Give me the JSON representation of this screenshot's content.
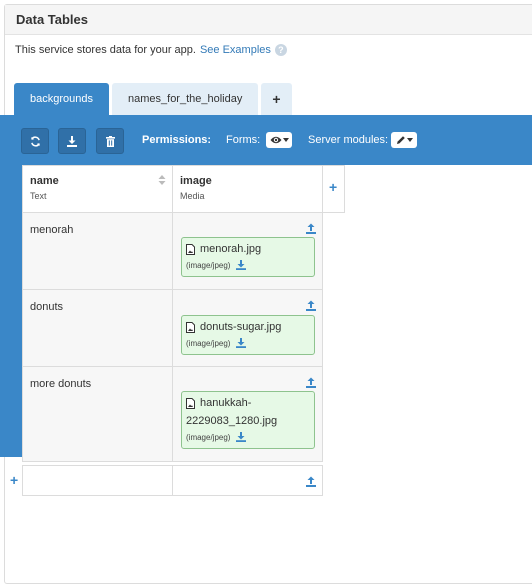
{
  "panel": {
    "title": "Data Tables"
  },
  "description": {
    "text": "This service stores data for your app.",
    "link": "See Examples",
    "help": "?"
  },
  "tabs": [
    {
      "label": "backgrounds",
      "active": true
    },
    {
      "label": "names_for_the_holiday",
      "active": false
    },
    {
      "label": "+",
      "active": false
    }
  ],
  "toolbar": {
    "permissions_label": "Permissions:",
    "forms_label": "Forms:",
    "forms_value_icon": "eye-icon",
    "server_label": "Server modules:",
    "server_value_icon": "pencil-icon",
    "buttons": [
      "refresh-icon",
      "download-icon",
      "trash-icon"
    ]
  },
  "columns": [
    {
      "name": "name",
      "type": "Text"
    },
    {
      "name": "image",
      "type": "Media"
    }
  ],
  "rows": [
    {
      "name": "menorah",
      "file": {
        "lines": [
          "menorah.jpg"
        ],
        "mime": "(image/jpeg)"
      }
    },
    {
      "name": "donuts",
      "file": {
        "lines": [
          "donuts-sugar.jpg"
        ],
        "mime": "(image/jpeg)"
      }
    },
    {
      "name": "more donuts",
      "file": {
        "lines": [
          "hanukkah-",
          "2229083_1280.jpg"
        ],
        "mime": "(image/jpeg)"
      }
    }
  ],
  "colors": {
    "accent": "#3a87c8",
    "file_bg": "#e6f9e6",
    "file_border": "#8ec38e"
  }
}
